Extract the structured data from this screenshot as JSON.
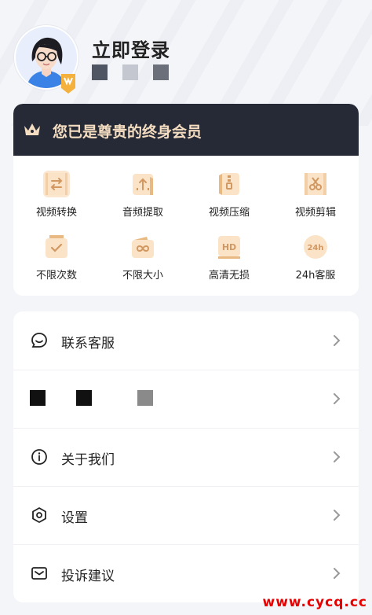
{
  "header": {
    "login_title": "立即登录",
    "id_blocks": [
      "#4f5563",
      "#c4c7cf",
      "#6b6f79"
    ]
  },
  "member": {
    "banner_text": "您已是尊贵的终身会员",
    "features": [
      {
        "label": "视频转换",
        "icon": "video-convert-icon"
      },
      {
        "label": "音频提取",
        "icon": "audio-extract-icon"
      },
      {
        "label": "视频压缩",
        "icon": "video-compress-icon"
      },
      {
        "label": "视频剪辑",
        "icon": "video-edit-icon"
      },
      {
        "label": "不限次数",
        "icon": "unlimited-times-icon"
      },
      {
        "label": "不限大小",
        "icon": "unlimited-size-icon"
      },
      {
        "label": "高清无损",
        "icon": "hd-lossless-icon"
      },
      {
        "label": "24h客服",
        "icon": "24h-service-icon",
        "badge": "24h"
      }
    ]
  },
  "menu": {
    "items": [
      {
        "label": "联系客服",
        "icon": "chat-icon"
      },
      {
        "label": "",
        "icon": "",
        "redacted_blocks": [
          "#111111",
          "#111111",
          "#8a8a8a"
        ]
      },
      {
        "label": "关于我们",
        "icon": "info-icon"
      },
      {
        "label": "设置",
        "icon": "settings-icon"
      },
      {
        "label": "投诉建议",
        "icon": "mail-icon"
      }
    ]
  },
  "watermark": "www.cycq.cc",
  "colors": {
    "banner_bg": "#262a36",
    "banner_text": "#f3dcc0",
    "feature_icon_bg": "#fbe7d0",
    "feature_icon_fg": "#d8a472"
  }
}
